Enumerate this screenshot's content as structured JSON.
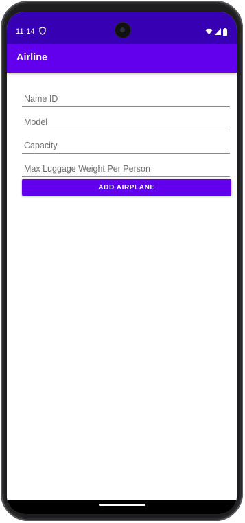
{
  "status_bar": {
    "time": "11:14",
    "icons": [
      "shield-icon",
      "wifi-icon",
      "signal-icon",
      "battery-icon"
    ],
    "background": "#3700b3"
  },
  "app_bar": {
    "title": "Airline",
    "background": "#6200ee"
  },
  "form": {
    "fields": [
      {
        "name": "name-id-field",
        "placeholder": "Name ID",
        "value": ""
      },
      {
        "name": "model-field",
        "placeholder": "Model",
        "value": ""
      },
      {
        "name": "capacity-field",
        "placeholder": "Capacity",
        "value": ""
      },
      {
        "name": "max-luggage-field",
        "placeholder": "Max Luggage Weight Per Person",
        "value": ""
      }
    ],
    "submit_label": "ADD AIRPLANE",
    "accent": "#6200ee"
  }
}
